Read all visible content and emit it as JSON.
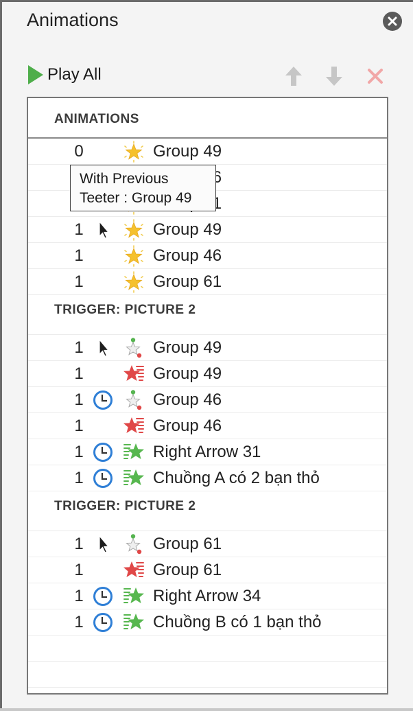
{
  "panel": {
    "title": "Animations"
  },
  "toolbar": {
    "play_all_label": "Play All",
    "move_up": "arrow-up-icon",
    "move_down": "arrow-down-icon",
    "remove": "delete-x-icon"
  },
  "colors": {
    "play_green": "#4fae4b",
    "entrance_yellow": "#f5c12e",
    "emphasis_green": "#57b74f",
    "exit_red": "#e04848",
    "clock_blue": "#2f7fd6",
    "disabled_gray": "#c6c6c6",
    "disabled_red": "#f1a7a7"
  },
  "list": {
    "header": "ANIMATIONS",
    "sections": [
      {
        "title": "",
        "rows": [
          {
            "order": "0",
            "trigger": "",
            "effect": "sparkle-star",
            "name": "Group 49"
          },
          {
            "order": "1",
            "trigger": "",
            "effect": "sparkle-star",
            "name": "Group 46"
          },
          {
            "order": "1",
            "trigger": "",
            "effect": "sparkle-star",
            "name": "Group 61"
          },
          {
            "order": "1",
            "trigger": "pointer",
            "effect": "sparkle-star",
            "name": "Group 49"
          },
          {
            "order": "1",
            "trigger": "",
            "effect": "sparkle-star",
            "name": "Group 46"
          },
          {
            "order": "1",
            "trigger": "",
            "effect": "sparkle-star",
            "name": "Group 61"
          }
        ]
      },
      {
        "title": "TRIGGER: PICTURE 2",
        "rows": [
          {
            "order": "1",
            "trigger": "pointer",
            "effect": "path-star",
            "name": "Group 49"
          },
          {
            "order": "1",
            "trigger": "",
            "effect": "exit-star",
            "name": "Group 49"
          },
          {
            "order": "1",
            "trigger": "clock",
            "effect": "path-star",
            "name": "Group 46"
          },
          {
            "order": "1",
            "trigger": "",
            "effect": "exit-star",
            "name": "Group 46"
          },
          {
            "order": "1",
            "trigger": "clock",
            "effect": "entrance-star",
            "name": "Right Arrow 31"
          },
          {
            "order": "1",
            "trigger": "clock",
            "effect": "entrance-star",
            "name": "Chuồng A có 2 bạn thỏ"
          }
        ]
      },
      {
        "title": "TRIGGER: PICTURE 2",
        "rows": [
          {
            "order": "1",
            "trigger": "pointer",
            "effect": "path-star",
            "name": "Group 61"
          },
          {
            "order": "1",
            "trigger": "",
            "effect": "exit-star",
            "name": "Group 61"
          },
          {
            "order": "1",
            "trigger": "clock",
            "effect": "entrance-star",
            "name": "Right Arrow 34"
          },
          {
            "order": "1",
            "trigger": "clock",
            "effect": "entrance-star",
            "name": "Chuồng B có 1 bạn thỏ"
          }
        ]
      }
    ]
  },
  "tooltip": {
    "line1": "With Previous",
    "line2": "Teeter : Group 49"
  }
}
